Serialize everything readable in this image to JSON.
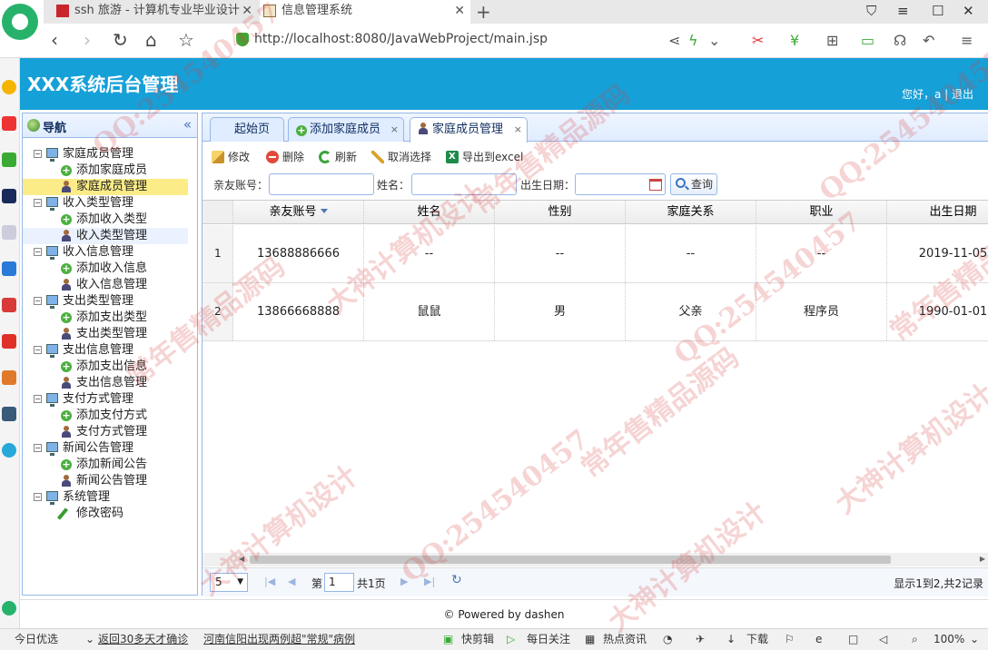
{
  "browser": {
    "tabs": [
      {
        "title": "ssh 旅游 - 计算机专业毕业设计",
        "close": "✕"
      },
      {
        "title": "信息管理系统",
        "close": "✕"
      }
    ],
    "new_tab": "+",
    "url": "http://localhost:8080/JavaWebProject/main.jsp"
  },
  "app": {
    "title": "XXX系统后台管理",
    "greeting": "您好，a | 退出"
  },
  "nav": {
    "title": "导航",
    "collapse": "«",
    "groups": [
      {
        "label": "家庭成员管理",
        "children": [
          {
            "label": "添加家庭成员",
            "icon": "add-icon"
          },
          {
            "label": "家庭成员管理",
            "icon": "user-icon",
            "selected": true
          }
        ]
      },
      {
        "label": "收入类型管理",
        "children": [
          {
            "label": "添加收入类型",
            "icon": "add-icon"
          },
          {
            "label": "收入类型管理",
            "icon": "user-icon",
            "hover": true
          }
        ]
      },
      {
        "label": "收入信息管理",
        "children": [
          {
            "label": "添加收入信息",
            "icon": "add-icon"
          },
          {
            "label": "收入信息管理",
            "icon": "user-icon"
          }
        ]
      },
      {
        "label": "支出类型管理",
        "children": [
          {
            "label": "添加支出类型",
            "icon": "add-icon"
          },
          {
            "label": "支出类型管理",
            "icon": "user-icon"
          }
        ]
      },
      {
        "label": "支出信息管理",
        "children": [
          {
            "label": "添加支出信息",
            "icon": "add-icon"
          },
          {
            "label": "支出信息管理",
            "icon": "user-icon"
          }
        ]
      },
      {
        "label": "支付方式管理",
        "children": [
          {
            "label": "添加支付方式",
            "icon": "add-icon"
          },
          {
            "label": "支付方式管理",
            "icon": "user-icon"
          }
        ]
      },
      {
        "label": "新闻公告管理",
        "children": [
          {
            "label": "添加新闻公告",
            "icon": "add-icon"
          },
          {
            "label": "新闻公告管理",
            "icon": "user-icon"
          }
        ]
      },
      {
        "label": "系统管理",
        "children": [
          {
            "label": "修改密码",
            "icon": "pencil-icon"
          }
        ]
      }
    ]
  },
  "tabs": {
    "home": "起始页",
    "add": "添加家庭成员",
    "manage": "家庭成员管理",
    "close": "×"
  },
  "toolbar": {
    "edit": "修改",
    "delete": "删除",
    "refresh": "刷新",
    "unselect": "取消选择",
    "export": "导出到excel"
  },
  "search": {
    "account_label": "亲友账号：",
    "name_label": "姓名：",
    "birth_label": "出生日期：",
    "query": "查询"
  },
  "grid": {
    "columns": [
      "亲友账号",
      "姓名",
      "性别",
      "家庭关系",
      "职业",
      "出生日期"
    ],
    "rows": [
      {
        "num": "1",
        "cells": [
          "13688886666",
          "--",
          "--",
          "--",
          "--",
          "2019-11-05"
        ]
      },
      {
        "num": "2",
        "cells": [
          "13866668888",
          "鼠鼠",
          "男",
          "父亲",
          "程序员",
          "1990-01-01"
        ]
      }
    ]
  },
  "pager": {
    "page_size": "5",
    "page_label": "第",
    "page_value": "1",
    "total_pages": "共1页",
    "info": "显示1到2,共2记录"
  },
  "footer": "© Powered by dashen",
  "statusbar": {
    "today": "今日优选",
    "news1": "返回30多天才确诊",
    "news2": "河南信阳出现两例超\"常规\"病例",
    "kuaijian": "快剪辑",
    "daily": "每日关注",
    "hot": "热点资讯",
    "download": "下载",
    "zoom": "100%"
  },
  "watermarks": [
    "QQ:254540457",
    "大神计算机设计",
    "常年售精品源码",
    "QQ:254540457",
    "大神计算机设计",
    "常年售精品源码",
    "QQ:254540457",
    "大神计算机设计",
    "常年售精品源码",
    "QQ:254540457",
    "大神计算机设计",
    "常年售精品源码"
  ]
}
